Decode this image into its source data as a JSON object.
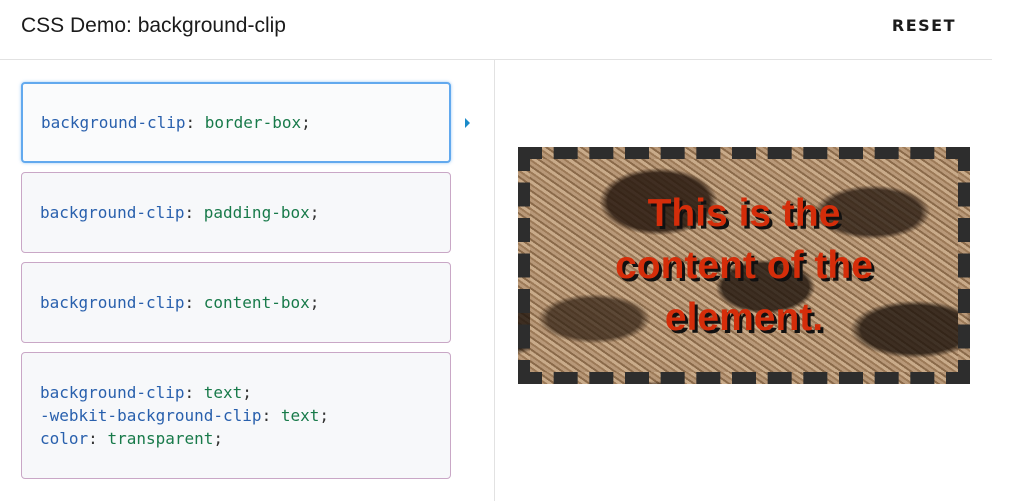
{
  "header": {
    "title": "CSS Demo: background-clip",
    "reset_label": "RESET"
  },
  "choices": [
    {
      "lines": [
        {
          "prop": "background-clip",
          "value": "border-box"
        }
      ],
      "selected": true
    },
    {
      "lines": [
        {
          "prop": "background-clip",
          "value": "padding-box"
        }
      ],
      "selected": false
    },
    {
      "lines": [
        {
          "prop": "background-clip",
          "value": "content-box"
        }
      ],
      "selected": false
    },
    {
      "lines": [
        {
          "prop": "background-clip",
          "value": "text"
        },
        {
          "prop": "-webkit-background-clip",
          "value": "text"
        },
        {
          "prop": "color",
          "value": "transparent"
        }
      ],
      "selected": false
    }
  ],
  "output": {
    "text": "This is the content of the element."
  },
  "colors": {
    "accent": "#62a9ee",
    "property": "#2960ad",
    "value": "#187a4a",
    "output_text": "#d42d0a"
  }
}
